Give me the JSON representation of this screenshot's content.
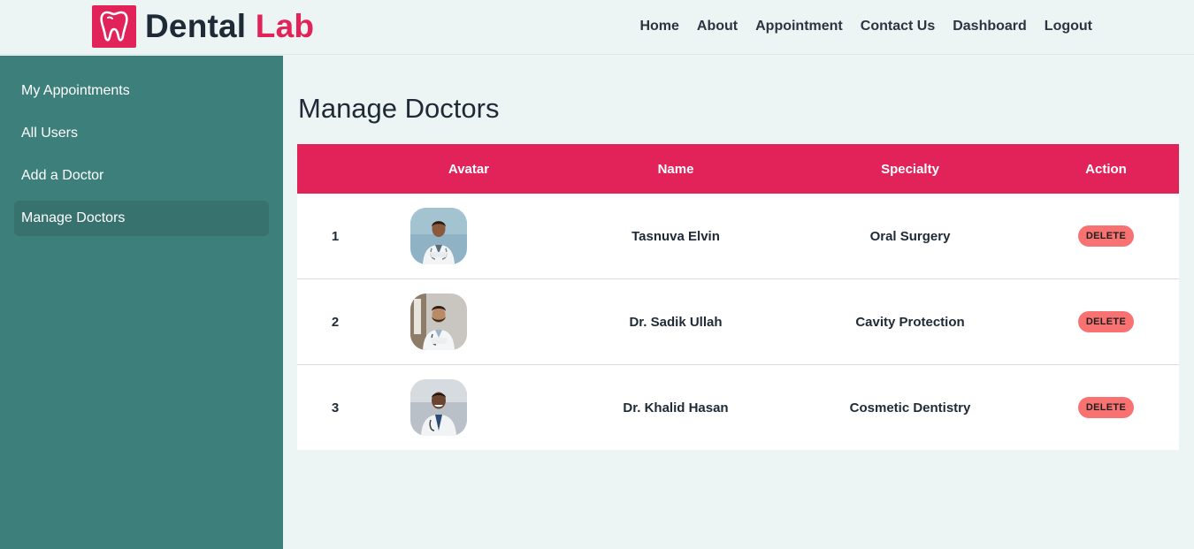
{
  "brand": {
    "name_part1": "Dental",
    "name_part2": "Lab",
    "accent_color": "#e1235a"
  },
  "nav": {
    "items": [
      {
        "label": "Home"
      },
      {
        "label": "About"
      },
      {
        "label": "Appointment"
      },
      {
        "label": "Contact Us"
      },
      {
        "label": "Dashboard"
      },
      {
        "label": "Logout"
      }
    ]
  },
  "sidebar": {
    "color": "#3d7f7b",
    "items": [
      {
        "label": "My Appointments",
        "active": false
      },
      {
        "label": "All Users",
        "active": false
      },
      {
        "label": "Add a Doctor",
        "active": false
      },
      {
        "label": "Manage Doctors",
        "active": true
      }
    ]
  },
  "main": {
    "title": "Manage Doctors",
    "table": {
      "headers": [
        "",
        "Avatar",
        "Name",
        "Specialty",
        "Action"
      ],
      "rows": [
        {
          "num": "1",
          "avatar_icon": "doctor-avatar",
          "name": "Tasnuva Elvin",
          "specialty": "Oral Surgery",
          "action": "DELETE"
        },
        {
          "num": "2",
          "avatar_icon": "doctor-avatar",
          "name": "Dr. Sadik Ullah",
          "specialty": "Cavity Protection",
          "action": "DELETE"
        },
        {
          "num": "3",
          "avatar_icon": "doctor-avatar",
          "name": "Dr. Khalid Hasan",
          "specialty": "Cosmetic Dentistry",
          "action": "DELETE"
        }
      ]
    }
  }
}
